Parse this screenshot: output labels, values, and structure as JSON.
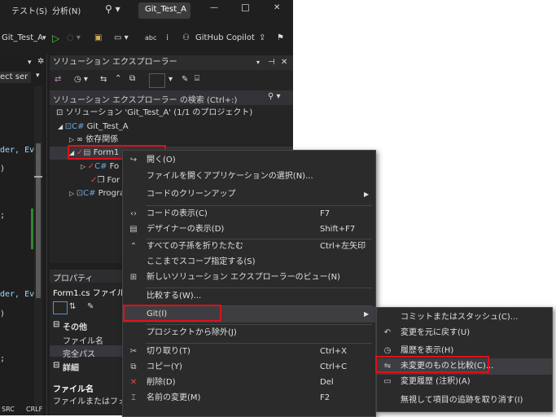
{
  "menubar": {
    "items": [
      "テスト(S)",
      "分析(N)"
    ],
    "search_icon": "search-icon",
    "tab_title": "Git_Test_A"
  },
  "window_controls": {
    "minimize": "—",
    "maximize": "☐",
    "close": "✕"
  },
  "toolbar": {
    "project": "Git_Test_A",
    "copilot": "GitHub Copilot"
  },
  "editor": {
    "dropdown": "ect ser",
    "lines": [
      {
        "text": "der, Ev",
        "color": "#9cdcfe"
      },
      {
        "text": ")",
        "color": "#dcdcdc"
      },
      {
        "text": ";",
        "color": "#dcdcdc"
      },
      {
        "text": "der, Ev",
        "color": "#9cdcfe"
      },
      {
        "text": ")",
        "color": "#dcdcdc"
      },
      {
        "text": ";",
        "color": "#dcdcdc"
      }
    ],
    "bottom_tabs": [
      "SRC",
      "CRLF"
    ]
  },
  "solution_explorer": {
    "title": "ソリューション エクスプローラー",
    "search_placeholder": "ソリューション エクスプローラー の検索 (Ctrl+:)",
    "tree": {
      "solution": "ソリューション 'Git_Test_A' (1/1 のプロジェクト)",
      "project": "Git_Test_A",
      "dependencies": "依存関係",
      "form1": "Form1",
      "child1": "Fo",
      "child2": "For",
      "program": "Progra"
    }
  },
  "properties": {
    "title": "プロパティ",
    "object": "Form1.cs ファイルの",
    "cat_other": "その他",
    "file_name": "ファイル名",
    "full_path": "完全パス",
    "cat_detail": "詳細",
    "desc_title": "ファイル名",
    "desc_text": "ファイルまたはフォルダ"
  },
  "context_menu": {
    "items": [
      {
        "label": "開く(O)",
        "shortcut": "",
        "icon": "open-icon"
      },
      {
        "label": "ファイルを開くアプリケーションの選択(N)...",
        "shortcut": "",
        "icon": ""
      },
      {
        "label": "コードのクリーンアップ",
        "shortcut": "",
        "icon": "",
        "submenu": true
      },
      {
        "label": "コードの表示(C)",
        "shortcut": "F7",
        "icon": "code-icon"
      },
      {
        "label": "デザイナーの表示(D)",
        "shortcut": "Shift+F7",
        "icon": "designer-icon"
      },
      {
        "label": "すべての子孫を折りたたむ",
        "shortcut": "Ctrl+左矢印",
        "icon": "collapse-icon"
      },
      {
        "label": "ここまでスコープ指定する(S)",
        "shortcut": "",
        "icon": ""
      },
      {
        "label": "新しいソリューション エクスプローラーのビュー(N)",
        "shortcut": "",
        "icon": "new-view-icon"
      },
      {
        "label": "比較する(W)...",
        "shortcut": "",
        "icon": ""
      },
      {
        "label": "Git(I)",
        "shortcut": "",
        "icon": "",
        "submenu": true
      },
      {
        "label": "プロジェクトから除外(J)",
        "shortcut": "",
        "icon": ""
      },
      {
        "label": "切り取り(T)",
        "shortcut": "Ctrl+X",
        "icon": "cut-icon"
      },
      {
        "label": "コピー(Y)",
        "shortcut": "Ctrl+C",
        "icon": "copy-icon"
      },
      {
        "label": "削除(D)",
        "shortcut": "Del",
        "icon": "delete-icon"
      },
      {
        "label": "名前の変更(M)",
        "shortcut": "F2",
        "icon": "rename-icon"
      }
    ]
  },
  "git_submenu": {
    "items": [
      {
        "label": "コミットまたはスタッシュ(C)...",
        "icon": ""
      },
      {
        "label": "変更を元に戻す(U)",
        "icon": "undo-icon"
      },
      {
        "label": "履歴を表示(H)",
        "icon": "history-icon"
      },
      {
        "label": "未変更のものと比較(C)...",
        "icon": "compare-icon"
      },
      {
        "label": "変更履歴 (注釈)(A)",
        "icon": "annotate-icon"
      },
      {
        "label": "無視して項目の追跡を取り消す(I)",
        "icon": ""
      }
    ]
  },
  "colors": {
    "highlight": "#e0101a",
    "accent": "#007acc",
    "menu_bg": "#2b2b2b"
  }
}
